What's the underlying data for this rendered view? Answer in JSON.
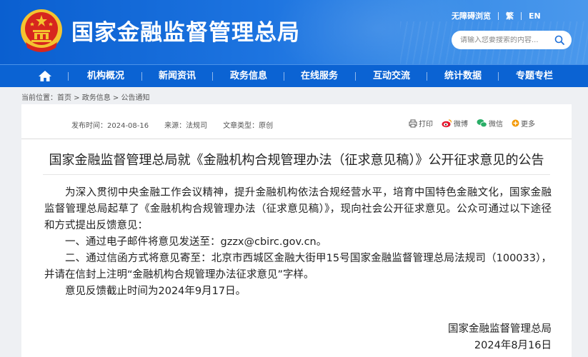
{
  "header": {
    "site_title": "国家金融监督管理总局",
    "top_links": [
      "无障碍浏览",
      "繁",
      "EN"
    ],
    "search_placeholder": "请输入您要搜索的内容..."
  },
  "nav": {
    "items": [
      "机构概况",
      "新闻资讯",
      "政务信息",
      "在线服务",
      "互动交流",
      "统计数据",
      "专题专栏"
    ]
  },
  "breadcrumb": {
    "label": "当前位置：",
    "items": [
      "首页",
      "政务信息",
      "公告通知"
    ],
    "separator": " > "
  },
  "article": {
    "meta": {
      "date_label": "发布时间：",
      "date": "2024-08-16",
      "source_label": "来源：",
      "source": "法规司",
      "type_label": "文章类型：",
      "type": "原创"
    },
    "share": [
      "打印",
      "微博",
      "微信",
      "更多"
    ],
    "title": "国家金融监督管理总局就《金融机构合规管理办法（征求意见稿）》公开征求意见的公告",
    "paragraphs": [
      "为深入贯彻中央金融工作会议精神，提升金融机构依法合规经营水平，培育中国特色金融文化，国家金融监督管理总局起草了《金融机构合规管理办法（征求意见稿）》，现向社会公开征求意见。公众可通过以下途径和方式提出反馈意见：",
      "一、通过电子邮件将意见发送至：gzzx@cbirc.gov.cn。",
      "二、通过信函方式将意见寄至：北京市西城区金融大街甲15号国家金融监督管理总局法规司（100033），并请在信封上注明“金融机构合规管理办法征求意见”字样。",
      "意见反馈截止时间为2024年9月17日。"
    ],
    "signature": {
      "org": "国家金融监督管理总局",
      "date": "2024年8月16日"
    }
  },
  "colors": {
    "header_blue": "#0a5fd0",
    "nav_blue": "#0b63d3",
    "emblem_red": "#d7261e",
    "emblem_gold": "#f4c430"
  }
}
